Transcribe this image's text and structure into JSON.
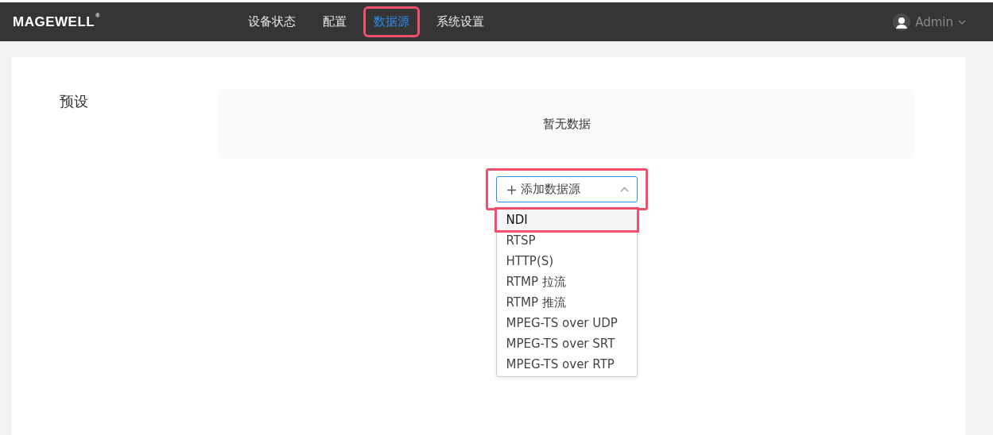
{
  "header": {
    "logo": "MAGEWELL",
    "logo_mark": "®",
    "nav": [
      {
        "label": "设备状态",
        "selected": false,
        "highlighted": false
      },
      {
        "label": "配置",
        "selected": false,
        "highlighted": false
      },
      {
        "label": "数据源",
        "selected": true,
        "highlighted": true
      },
      {
        "label": "系统设置",
        "selected": false,
        "highlighted": false
      }
    ],
    "user": {
      "name": "Admin"
    }
  },
  "section": {
    "label": "预设",
    "empty_text": "暂无数据",
    "add_select": {
      "placeholder": "添加数据源",
      "plus": "+",
      "expanded": true,
      "highlighted": true
    },
    "options": [
      {
        "label": "NDI",
        "hovered": true,
        "highlighted": true
      },
      {
        "label": "RTSP",
        "hovered": false,
        "highlighted": false
      },
      {
        "label": "HTTP(S)",
        "hovered": false,
        "highlighted": false
      },
      {
        "label": "RTMP 拉流",
        "hovered": false,
        "highlighted": false
      },
      {
        "label": "RTMP 推流",
        "hovered": false,
        "highlighted": false
      },
      {
        "label": "MPEG-TS over UDP",
        "hovered": false,
        "highlighted": false
      },
      {
        "label": "MPEG-TS over SRT",
        "hovered": false,
        "highlighted": false
      },
      {
        "label": "MPEG-TS over RTP",
        "hovered": false,
        "highlighted": false
      }
    ]
  }
}
